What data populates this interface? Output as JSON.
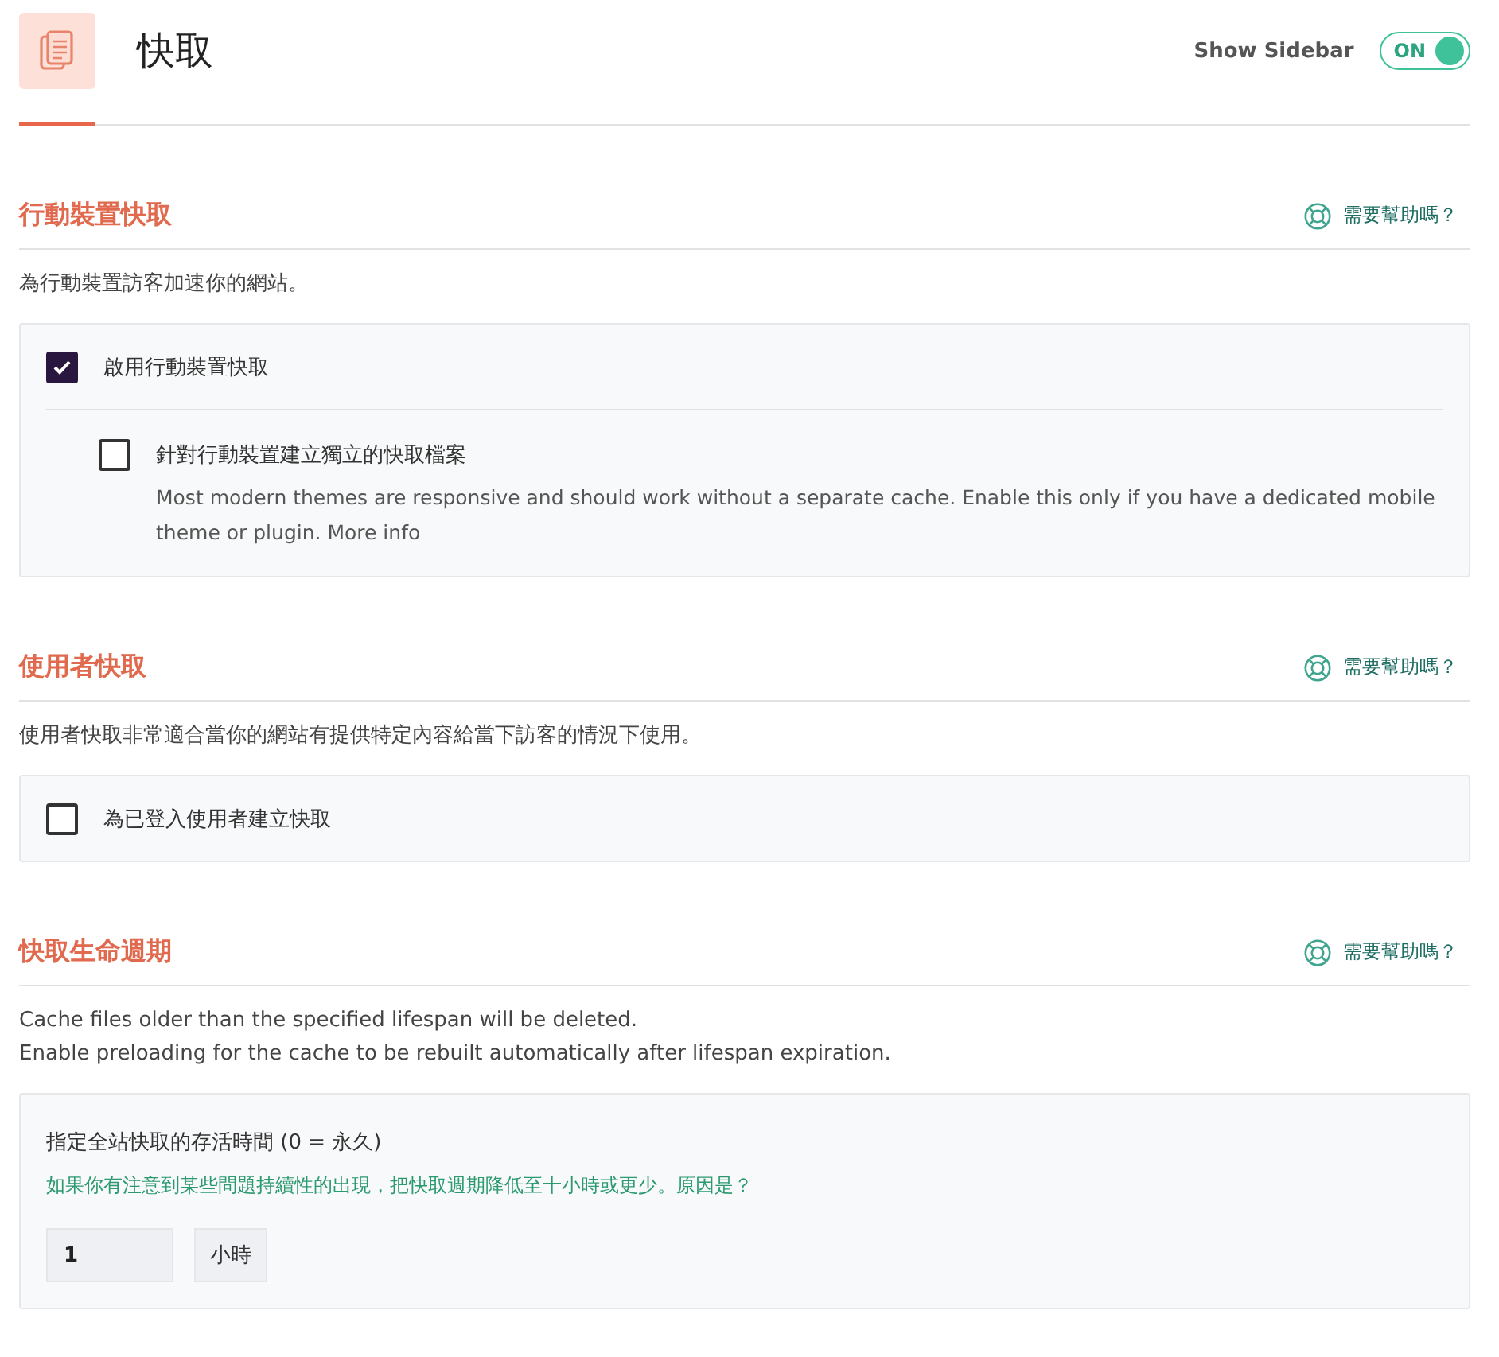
{
  "header": {
    "title": "快取",
    "sidebar_label": "Show Sidebar",
    "sidebar_toggle": {
      "label": "ON",
      "on": true
    }
  },
  "sections": [
    {
      "title": "行動裝置快取",
      "help": "需要幫助嗎？",
      "description": [
        "為行動裝置訪客加速你的網站。"
      ],
      "panel": {
        "kind": "checkboxes",
        "options": [
          {
            "label": "啟用行動裝置快取",
            "checked": true,
            "children": [
              {
                "label": "針對行動裝置建立獨立的快取檔案",
                "checked": false,
                "note": "Most modern themes are responsive and should work without a separate cache. Enable this only if you have a dedicated mobile theme or plugin. More info"
              }
            ]
          }
        ]
      }
    },
    {
      "title": "使用者快取",
      "help": "需要幫助嗎？",
      "description": [
        "使用者快取非常適合當你的網站有提供特定內容給當下訪客的情況下使用。"
      ],
      "panel": {
        "kind": "checkboxes",
        "options": [
          {
            "label": "為已登入使用者建立快取",
            "checked": false
          }
        ]
      }
    },
    {
      "title": "快取生命週期",
      "help": "需要幫助嗎？",
      "description": [
        "Cache files older than the specified lifespan will be deleted.",
        "Enable preloading for the cache to be rebuilt automatically after lifespan expiration."
      ],
      "panel": {
        "kind": "lifespan",
        "label": "指定全站快取的存活時間 (0 = 永久)",
        "hint": "如果你有注意到某些問題持續性的出現，把快取週期降低至十小時或更少。原因是？",
        "value": "1",
        "unit": "小時"
      }
    }
  ]
}
